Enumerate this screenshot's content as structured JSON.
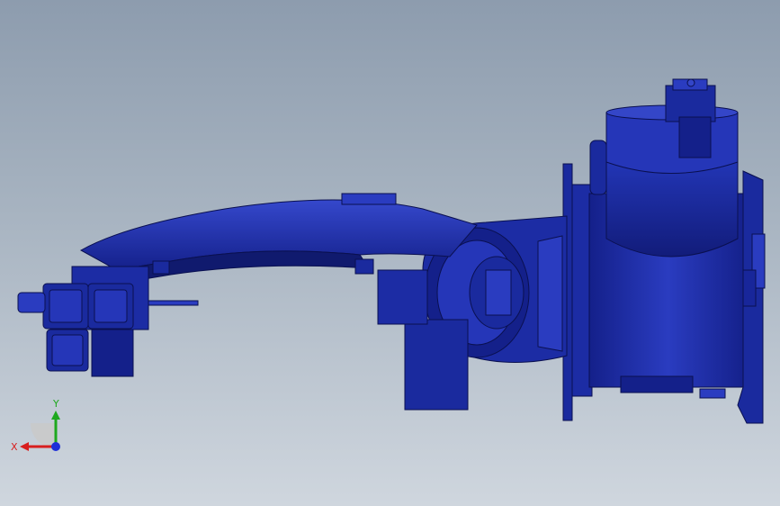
{
  "viewport": {
    "background_top": "#8d9cae",
    "background_bottom": "#cfd6de"
  },
  "model": {
    "part_color": "#1f2fa6",
    "part_color_light": "#3446c8",
    "part_color_dark": "#101a6e",
    "edge_color": "#0a1050"
  },
  "triad": {
    "x_label": "X",
    "y_label": "Y",
    "x_color": "#d81e1e",
    "y_color": "#1ea81e",
    "z_color": "#1e2ed8"
  }
}
